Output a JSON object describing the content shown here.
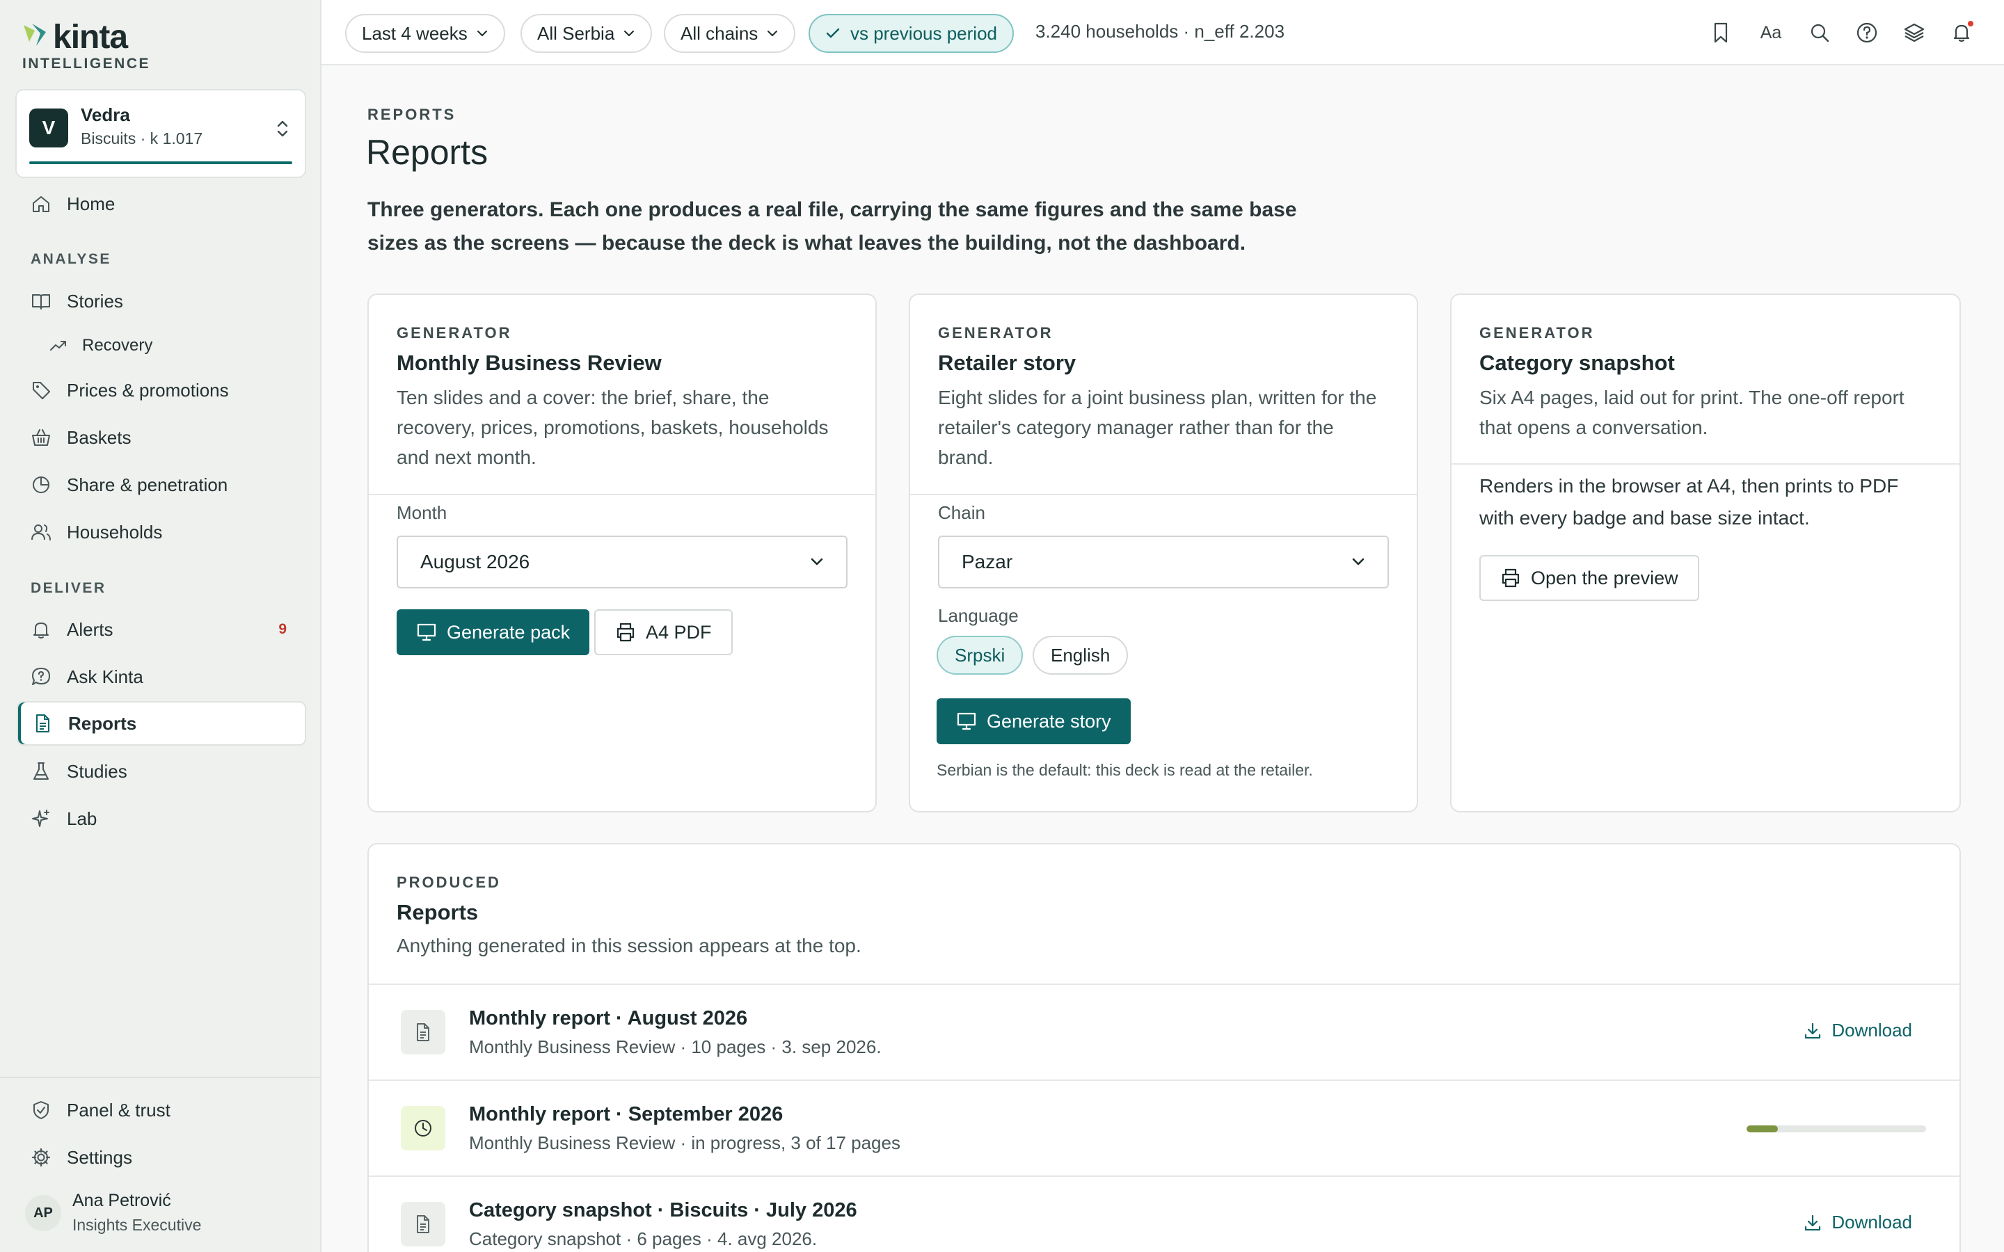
{
  "app": {
    "brand": "kinta",
    "brand_sub": "INTELLIGENCE",
    "accent": "#0d6467"
  },
  "workspace": {
    "initial": "V",
    "name": "Vedra",
    "meta": "Biscuits · k 1.017"
  },
  "sidebar": {
    "home": "Home",
    "analyse_label": "ANALYSE",
    "stories": "Stories",
    "recovery": "Recovery",
    "prices": "Prices & promotions",
    "baskets": "Baskets",
    "share": "Share & penetration",
    "households": "Households",
    "deliver_label": "DELIVER",
    "alerts": "Alerts",
    "alerts_count": "9",
    "ask": "Ask Kinta",
    "reports": "Reports",
    "studies": "Studies",
    "lab": "Lab",
    "panel": "Panel & trust",
    "settings": "Settings"
  },
  "user": {
    "initials": "AP",
    "name": "Ana Petrović",
    "role": "Insights Executive"
  },
  "topbar": {
    "period": "Last 4 weeks",
    "region": "All Serbia",
    "chains": "All chains",
    "compare": "vs previous period",
    "meta": "3.240 households · n_eff 2.203",
    "font_label": "Aa"
  },
  "page": {
    "eyebrow": "REPORTS",
    "title": "Reports",
    "lede": "Three generators. Each one produces a real file, carrying the same figures and the same base sizes as the screens — because the deck is what leaves the building, not the dashboard."
  },
  "generators": {
    "mbr": {
      "eyebrow": "GENERATOR",
      "title": "Monthly Business Review",
      "desc": "Ten slides and a cover: the brief, share, the recovery, prices, promotions, baskets, households and next month.",
      "month_label": "Month",
      "month_value": "August 2026",
      "generate": "Generate pack",
      "pdf": "A4 PDF"
    },
    "retailer": {
      "eyebrow": "GENERATOR",
      "title": "Retailer story",
      "desc": "Eight slides for a joint business plan, written for the retailer's category manager rather than for the brand.",
      "chain_label": "Chain",
      "chain_value": "Pazar",
      "language_label": "Language",
      "lang_sr": "Srpski",
      "lang_en": "English",
      "generate": "Generate story",
      "note": "Serbian is the default: this deck is read at the retailer."
    },
    "snapshot": {
      "eyebrow": "GENERATOR",
      "title": "Category snapshot",
      "desc": "Six A4 pages, laid out for print. The one-off report that opens a conversation.",
      "text": "Renders in the browser at A4, then prints to PDF with every badge and base size intact.",
      "preview": "Open the preview"
    }
  },
  "produced": {
    "eyebrow": "PRODUCED",
    "title": "Reports",
    "sub": "Anything generated in this session appears at the top.",
    "download": "Download",
    "rows": [
      {
        "title": "Monthly report · August 2026",
        "meta": "Monthly Business Review · 10 pages · 3. sep 2026."
      },
      {
        "title": "Monthly report · September 2026",
        "meta": "Monthly Business Review · in progress, 3 of 17 pages",
        "progress": 0.176
      },
      {
        "title": "Category snapshot · Biscuits · July 2026",
        "meta": "Category snapshot · 6 pages · 4. avg 2026."
      }
    ]
  }
}
